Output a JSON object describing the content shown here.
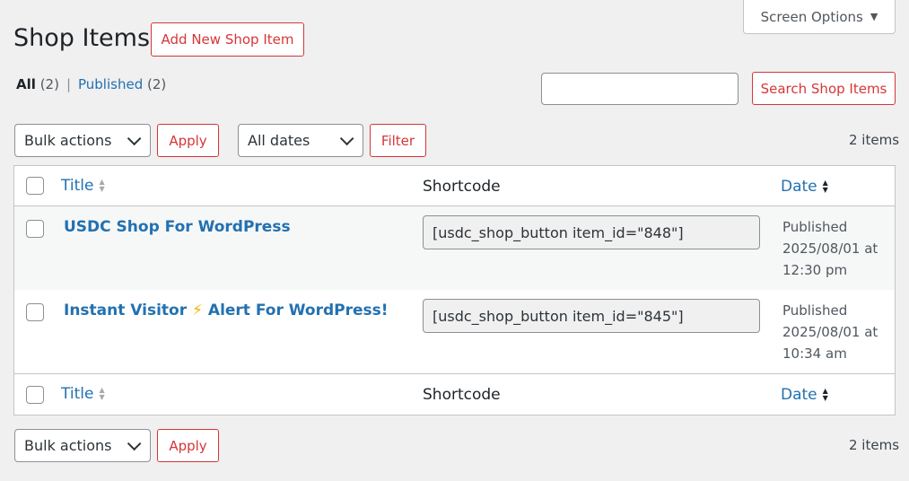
{
  "screen_options": {
    "label": "Screen Options",
    "caret_icon": "triangle-down-icon"
  },
  "page": {
    "title": "Shop Items",
    "add_new_label": "Add New Shop Item"
  },
  "views": {
    "all": {
      "label": "All",
      "count": "(2)"
    },
    "separator": "|",
    "published": {
      "label": "Published",
      "count": "(2)"
    }
  },
  "search": {
    "value": "",
    "button_label": "Search Shop Items"
  },
  "top_nav": {
    "bulk_actions": "Bulk actions",
    "apply": "Apply",
    "dates": "All dates",
    "filter": "Filter",
    "items_count": "2 items"
  },
  "bottom_nav": {
    "bulk_actions": "Bulk actions",
    "apply": "Apply",
    "items_count": "2 items"
  },
  "table": {
    "columns": {
      "title": "Title",
      "shortcode": "Shortcode",
      "date": "Date"
    },
    "rows": [
      {
        "title": "USDC Shop For WordPress",
        "shortcode": "[usdc_shop_button item_id=\"848\"]",
        "status": "Published",
        "date": "2025/08/01 at",
        "time": "12:30 pm"
      },
      {
        "title_before": "Instant Visitor",
        "title_emoji": "⚡",
        "title_after": "Alert For WordPress!",
        "shortcode": "[usdc_shop_button item_id=\"845\"]",
        "status": "Published",
        "date": "2025/08/01 at",
        "time": "10:34 am"
      }
    ]
  },
  "colors": {
    "accent_red": "#d63638",
    "link_blue": "#2271b1",
    "background": "#f0f0f1"
  }
}
